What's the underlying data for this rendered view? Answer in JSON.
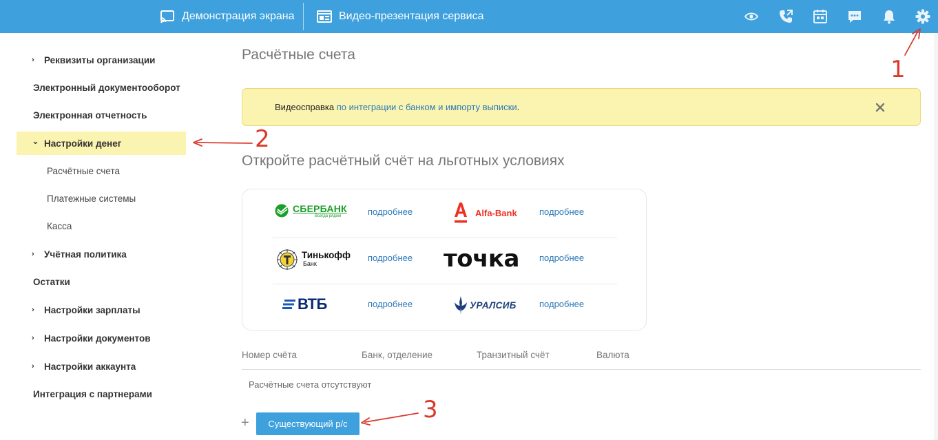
{
  "topbar": {
    "screen_demo_label": "Демонстрация экрана",
    "video_presentation_label": "Видео-презентация сервиса",
    "icons": [
      "eye-icon",
      "phone-icon",
      "calendar-icon",
      "chat-icon",
      "bell-icon",
      "gear-icon"
    ]
  },
  "sidebar": {
    "items": [
      {
        "label": "Реквизиты организации",
        "chevron": "›"
      },
      {
        "label": "Электронный документооборот"
      },
      {
        "label": "Электронная отчетность"
      },
      {
        "label": "Настройки денег",
        "chevron": "⌄",
        "active": true
      },
      {
        "label": "Расчётные счета"
      },
      {
        "label": "Платежные системы"
      },
      {
        "label": "Касса"
      },
      {
        "label": "Учётная политика",
        "chevron": "›"
      },
      {
        "label": "Остатки"
      },
      {
        "label": "Настройки зарплаты",
        "chevron": "›"
      },
      {
        "label": "Настройки документов",
        "chevron": "›"
      },
      {
        "label": "Настройки аккаунта",
        "chevron": "›"
      },
      {
        "label": "Интеграция с партнерами"
      }
    ]
  },
  "main": {
    "title": "Расчётные счета",
    "notice": {
      "prefix": "Видеосправка",
      "link": "по интеграции с банком и импорту выписки",
      "suffix": "."
    },
    "promo_title": "Откройте расчётный счёт на льготных условиях",
    "banks": [
      {
        "name": "СБЕРБАНК",
        "tagline": "Всегда рядом",
        "more": "подробнее"
      },
      {
        "name": "Alfa-Bank",
        "more": "подробнее"
      },
      {
        "name": "Тинькофф",
        "tagline": "Банк",
        "more": "подробнее"
      },
      {
        "name": "точка",
        "more": "подробнее"
      },
      {
        "name": "ВТБ",
        "more": "подробнее"
      },
      {
        "name": "УРАЛСИБ",
        "more": "подробнее"
      }
    ],
    "table": {
      "headers": [
        "Номер счёта",
        "Банк, отделение",
        "Транзитный счёт",
        "Валюта"
      ],
      "empty_text": "Расчётные счета отсутствуют"
    },
    "add_plus": "+",
    "existing_account_button": "Существующий р/с"
  },
  "annotations": [
    "1",
    "2",
    "3"
  ],
  "colors": {
    "topbar": "#3ea0dc",
    "highlight": "#fbf3b0",
    "link": "#2b79b8",
    "annotation": "#d93a2b"
  }
}
